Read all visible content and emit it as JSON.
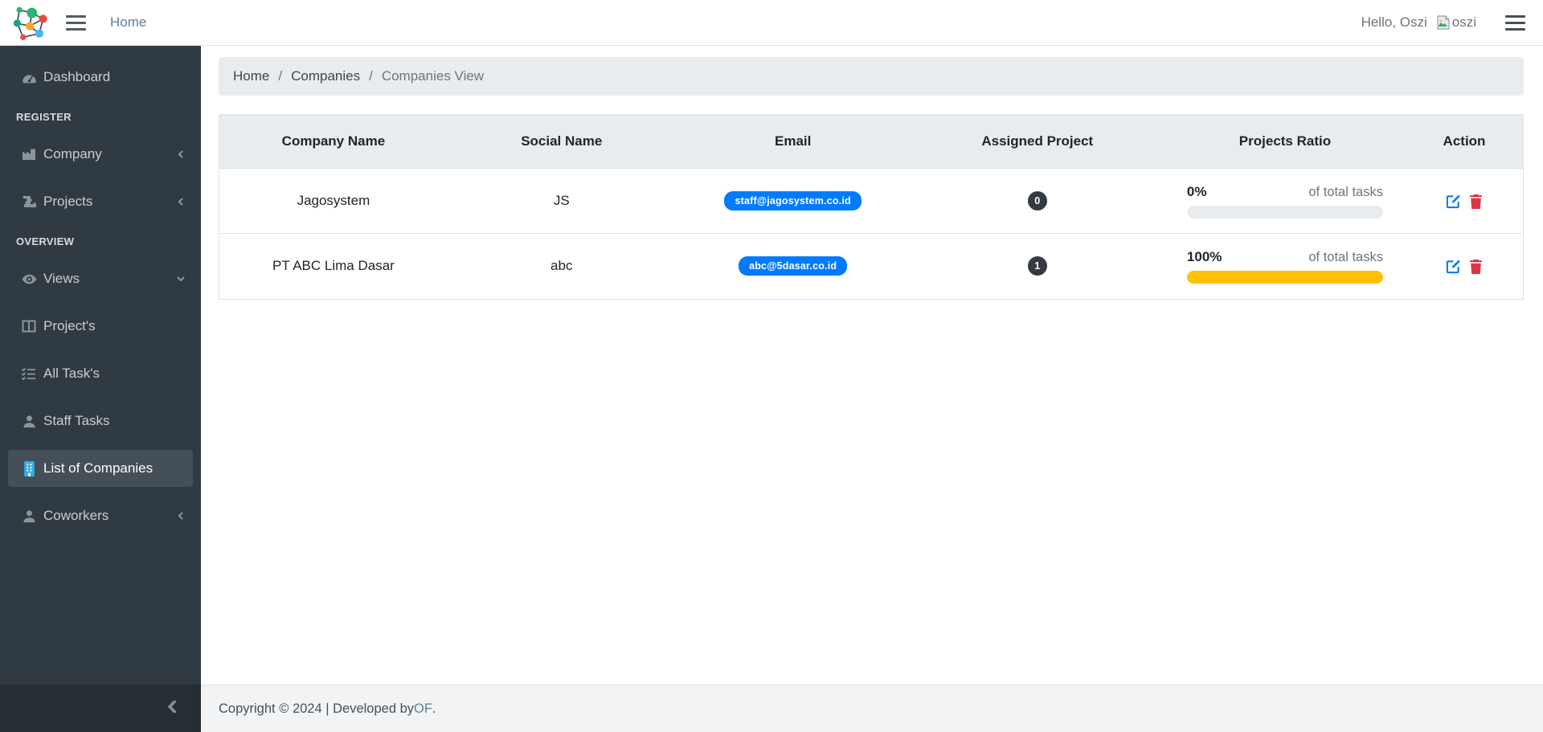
{
  "navbar": {
    "home_label": "Home",
    "greeting": "Hello, Oszi",
    "avatar_alt": "oszi"
  },
  "sidebar": {
    "sections": [
      {
        "header": "",
        "items": [
          {
            "label": "Dashboard",
            "icon": "tachometer-icon"
          }
        ]
      },
      {
        "header": "REGISTER",
        "items": [
          {
            "label": "Company",
            "icon": "industry-icon",
            "chevron": "left"
          },
          {
            "label": "Projects",
            "icon": "puzzle-icon",
            "chevron": "left"
          }
        ]
      },
      {
        "header": "OVERVIEW",
        "items": [
          {
            "label": "Views",
            "icon": "eye-icon",
            "chevron": "down"
          },
          {
            "label": "Project's",
            "icon": "columns-icon"
          },
          {
            "label": "All Task's",
            "icon": "tasks-icon"
          },
          {
            "label": "Staff Tasks",
            "icon": "user-icon"
          },
          {
            "label": "List of Companies",
            "icon": "building-icon",
            "active": true
          },
          {
            "label": "Coworkers",
            "icon": "user-icon",
            "chevron": "left"
          }
        ]
      }
    ]
  },
  "breadcrumb": {
    "separator": "/",
    "items": [
      {
        "label": "Home",
        "active": false
      },
      {
        "label": "Companies",
        "active": false
      },
      {
        "label": "Companies View",
        "active": true
      }
    ]
  },
  "table": {
    "columns": [
      "Company Name",
      "Social Name",
      "Email",
      "Assigned Project",
      "Projects Ratio",
      "Action"
    ],
    "rows": [
      {
        "company_name": "Jagosystem",
        "social_name": "JS",
        "email": "staff@jagosystem.co.id",
        "assigned_project": "0",
        "ratio_percent": "0%",
        "ratio_value": 0,
        "ratio_caption": "of total tasks"
      },
      {
        "company_name": "PT ABC Lima Dasar",
        "social_name": "abc",
        "email": "abc@5dasar.co.id",
        "assigned_project": "1",
        "ratio_percent": "100%",
        "ratio_value": 100,
        "ratio_caption": "of total tasks"
      }
    ]
  },
  "footer": {
    "prefix": "Copyright © 2024 | Developed by ",
    "link_text": "OF",
    "suffix": "."
  },
  "colors": {
    "accent_blue": "#007bff",
    "badge_dark": "#343a40",
    "progress_yellow": "#ffc107",
    "danger_red": "#dc3545",
    "sidebar_bg": "#2f3a42",
    "breadcrumb_bg": "#e9ecef",
    "nav_link_blue": "#5d7e9c"
  }
}
